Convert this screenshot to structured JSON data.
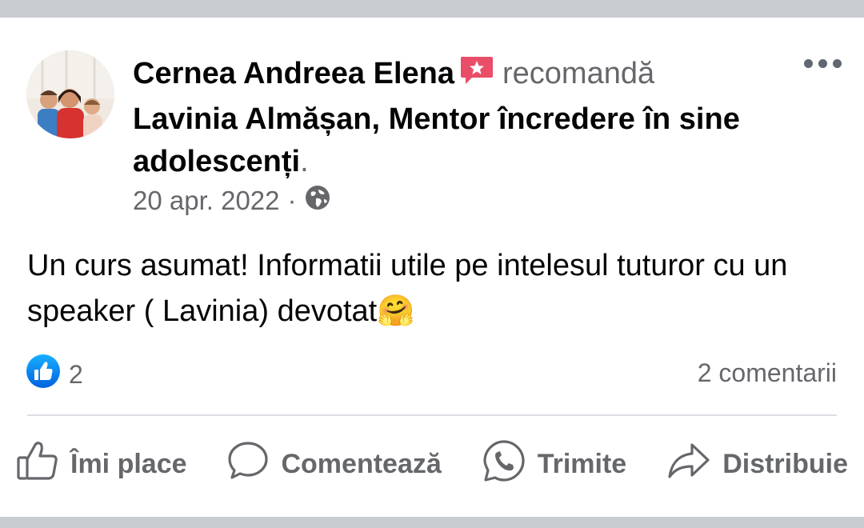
{
  "post": {
    "author": "Cernea Andreea Elena",
    "verb": "recomandă",
    "target": "Lavinia Almășan, Mentor încredere în sine adolescenți",
    "period": ".",
    "date": "20 apr. 2022",
    "separator": "·",
    "audience_icon": "globe-icon",
    "body_text": "Un curs asumat! Informatii utile pe intelesul tuturor cu un speaker ( Lavinia) devotat",
    "body_emoji": "🤗",
    "more_icon": "more-horizontal-icon",
    "badge_icon": "recommendation-star-badge-icon",
    "accent_color": "#e94d68"
  },
  "stats": {
    "like_icon": "like-reaction-icon",
    "like_count": "2",
    "comments": "2 comentarii"
  },
  "actions": {
    "like": "Îmi place",
    "comment": "Comentează",
    "send": "Trimite",
    "share": "Distribuie"
  },
  "colors": {
    "like_blue": "#1877f2",
    "secondary_text": "#65676b",
    "primary_text": "#050505",
    "background_bar": "#c9ccd1"
  }
}
